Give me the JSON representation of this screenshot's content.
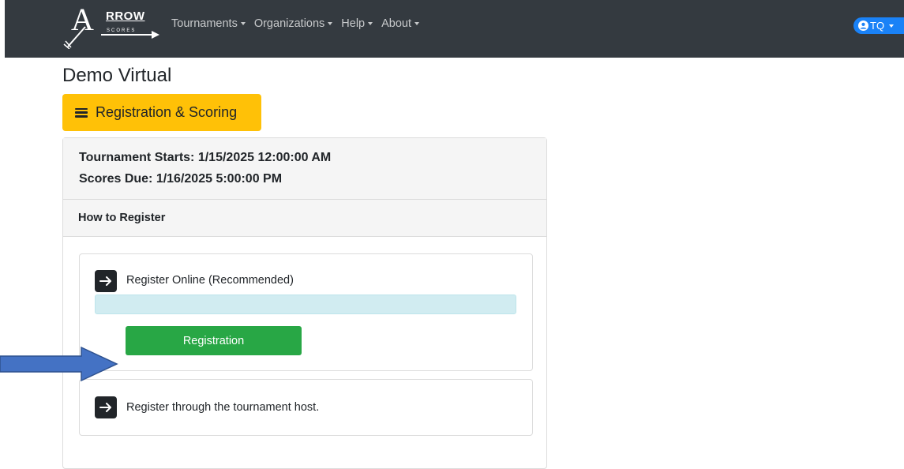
{
  "navbar": {
    "logo": {
      "word": "RROW",
      "initial": "A",
      "sub": "SCORES"
    },
    "menu": [
      {
        "label": "Tournaments"
      },
      {
        "label": "Organizations"
      },
      {
        "label": "Help"
      },
      {
        "label": "About"
      }
    ],
    "user": {
      "label": "TQ"
    }
  },
  "page": {
    "title": "Demo Virtual",
    "menu_button": "Registration & Scoring"
  },
  "tournament": {
    "starts": "Tournament Starts: 1/15/2025 12:00:00 AM",
    "scores_due": "Scores Due: 1/16/2025 5:00:00 PM"
  },
  "registration": {
    "header": "How to Register",
    "options": [
      {
        "label": "Register Online (Recommended)",
        "button": "Registration"
      },
      {
        "label": "Register through the tournament host."
      }
    ]
  },
  "colors": {
    "navbar": "#343a40",
    "menu_button": "#ffc107",
    "registration_button": "#28a745",
    "info_bar": "#d1ecf1",
    "user_button": "#1a82f7",
    "callout_arrow": "#4472c4"
  }
}
